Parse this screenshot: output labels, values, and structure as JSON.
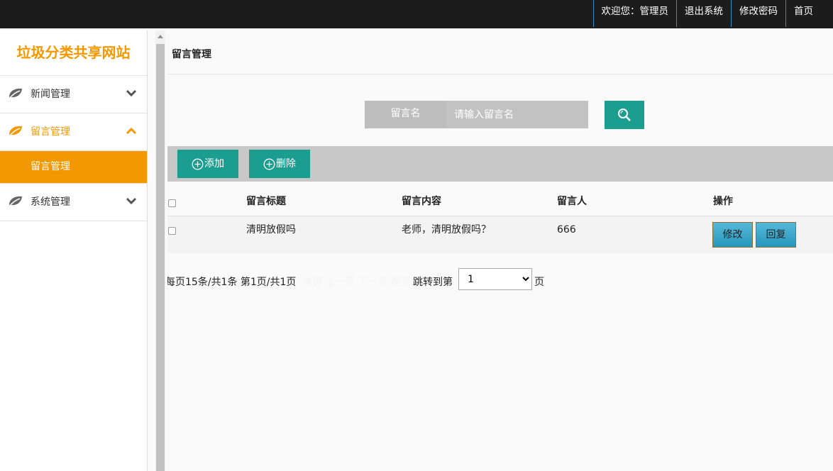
{
  "topbar": {
    "items": [
      "欢迎您：管理员",
      "退出系统",
      "修改密码",
      "首页"
    ]
  },
  "sidebar": {
    "brand": "垃圾分类共享网站",
    "groups": [
      {
        "label": "新闻管理",
        "icon": "leaf-icon",
        "expanded": false
      },
      {
        "label": "留言管理",
        "icon": "leaf-icon",
        "expanded": true,
        "children": [
          "留言管理"
        ]
      },
      {
        "label": "系统管理",
        "icon": "leaf-icon",
        "expanded": false
      }
    ]
  },
  "main": {
    "page_title": "留言管理",
    "search": {
      "label": "留言名",
      "placeholder": "请输入留言名",
      "button_icon": "search-icon"
    },
    "toolbar": {
      "add_label": "添加",
      "delete_label": "删除"
    },
    "table": {
      "columns": [
        "留言标题",
        "留言内容",
        "留言人",
        "操作"
      ],
      "rows": [
        {
          "title": "清明放假吗",
          "content": "老师，清明放假吗？",
          "author": "666",
          "actions": [
            "修改",
            "回复"
          ]
        }
      ]
    },
    "pager": {
      "info": "每页15条/共1条 第1页/共1页",
      "links": "首页 上一页 下一页 尾页",
      "jump_label": "跳转到第",
      "page_option": "1",
      "unit": "页"
    }
  },
  "colors": {
    "accent": "#f39800",
    "teal": "#1b9e8f",
    "topbar": "#1c1c1c"
  }
}
